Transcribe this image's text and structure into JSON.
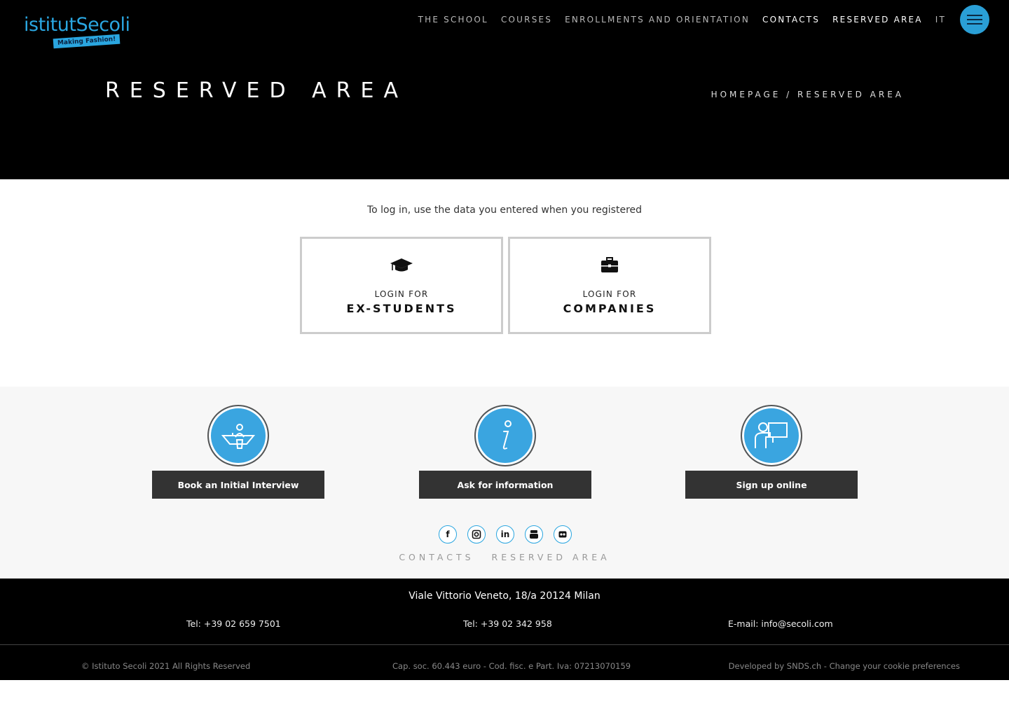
{
  "header": {
    "logo_text": "istitutSecoli",
    "logo_tagline": "Making Fashion!",
    "nav": [
      {
        "label": "THE SCHOOL"
      },
      {
        "label": "COURSES"
      },
      {
        "label": "ENROLLMENTS AND ORIENTATION"
      },
      {
        "label": "CONTACTS"
      },
      {
        "label": "RESERVED AREA"
      },
      {
        "label": "IT"
      }
    ],
    "page_title": "RESERVED AREA",
    "breadcrumb": {
      "home": "HOMEPAGE",
      "separator": " / ",
      "current": "RESERVED AREA"
    }
  },
  "main": {
    "intro": "To log in, use the data you entered when you registered",
    "login_students": {
      "pre": "LOGIN FOR",
      "label": "EX-STUDENTS",
      "icon": "graduation-cap-icon"
    },
    "login_companies": {
      "pre": "LOGIN FOR",
      "label": "COMPANIES",
      "icon": "briefcase-icon"
    }
  },
  "actions": [
    {
      "label": "Book an Initial Interview",
      "icon": "interview-desk-icon"
    },
    {
      "label": "Ask for information",
      "icon": "info-icon"
    },
    {
      "label": "Sign up online",
      "icon": "online-signup-icon"
    }
  ],
  "social": [
    {
      "label": "f",
      "icon": "facebook-icon"
    },
    {
      "label": "",
      "icon": "instagram-icon"
    },
    {
      "label": "in",
      "icon": "linkedin-icon"
    },
    {
      "label": "",
      "icon": "youtube-icon"
    },
    {
      "label": "",
      "icon": "flickr-icon"
    }
  ],
  "footer_links": {
    "contacts": "CONTACTS",
    "reserved": "RESERVED AREA"
  },
  "footer": {
    "address": "Viale Vittorio Veneto, 18/a 20124 Milan",
    "tel1": "Tel: +39 02 659 7501",
    "tel2": "Tel: +39 02 342 958",
    "email": "E-mail: info@secoli.com",
    "copyright": "© Istituto Secoli 2021 All Rights Reserved",
    "company_info": "Cap. soc. 60.443 euro - Cod. fisc. e Part. Iva: 07213070159",
    "developed_by": "Developed by SNDS.ch",
    "developed_separator": " - ",
    "cookie_link": "Change your cookie preferences"
  },
  "colors": {
    "accent": "#2aa6e0",
    "dark_button": "#333333",
    "header_bg": "#000000"
  }
}
